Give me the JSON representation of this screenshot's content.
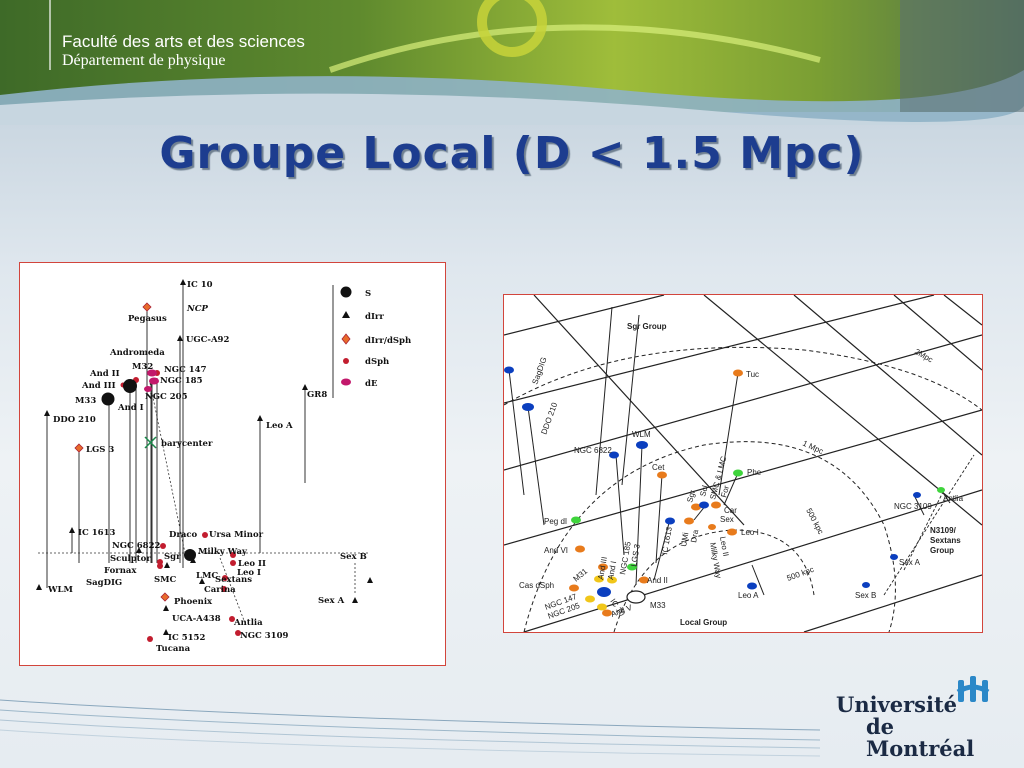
{
  "header": {
    "faculty": "Faculté des arts et des sciences",
    "department": "Département de physique"
  },
  "slide": {
    "title": "Groupe Local (D < 1.5 Mpc)"
  },
  "left_diagram": {
    "legend": [
      {
        "symbol": "S",
        "shape": "circle-large"
      },
      {
        "symbol": "dIrr",
        "shape": "triangle"
      },
      {
        "symbol": "dIrr/dSph",
        "shape": "diamond"
      },
      {
        "symbol": "dSph",
        "shape": "dot"
      },
      {
        "symbol": "dE",
        "shape": "ellipse"
      }
    ],
    "barycenter_label": "barycenter",
    "labels": {
      "ic10": "IC 10",
      "ncp": "NCP",
      "pegasus": "Pegasus",
      "ugca92": "UGC-A92",
      "andromeda": "Andromeda",
      "and2": "And II",
      "m32": "M32",
      "ngc147": "NGC 147",
      "and3": "And III",
      "ngc185": "NGC 185",
      "m33": "M33",
      "ngc205": "NGC 205",
      "and1": "And I",
      "gr8": "GR8",
      "ddo210": "DDO 210",
      "leoa": "Leo A",
      "lgs3": "LGS 3",
      "ic1613": "IC 1613",
      "draco": "Draco",
      "ursaminor": "Ursa Minor",
      "ngc6822": "NGC 6822",
      "milkyway": "Milky Way",
      "sculptor": "Sculptor",
      "sgr": "Sgr",
      "leo2": "Leo II",
      "fornax": "Fornax",
      "lmc": "LMC",
      "leo1": "Leo I",
      "sagdig": "SagDIG",
      "smc": "SMC",
      "sextans": "Sextans",
      "carina": "Carina",
      "wlm": "WLM",
      "sexb": "Sex B",
      "phoenix": "Phoenix",
      "sexa": "Sex A",
      "uca438": "UCA-A438",
      "antlia": "Antlia",
      "ic5152": "IC 5152",
      "ngc3109": "NGC 3109",
      "tucana": "Tucana"
    }
  },
  "right_diagram": {
    "labels": {
      "sgrgroup": "Sgr Group",
      "tuc": "Tuc",
      "sagdig": "SagDIG",
      "ddo210": "DDO 210",
      "twompc": "2Mpc",
      "ngc6822": "NGC 6822",
      "wlm": "WLM",
      "onempc": "1 Mpc",
      "cet": "Cet",
      "phe": "Phe",
      "smclmc": "SMC & LMC",
      "sgr": "Sgr",
      "scl": "Scl",
      "for": "For",
      "car": "Car",
      "sex": "Sex",
      "peg": "Peg dI",
      "umi": "UMi",
      "dra": "Dra",
      "milkyway": "Milky Way",
      "leo2": "Leo II",
      "leo1": "Leo I",
      "ic1613": "IC 1613",
      "fivehundred1": "500 kpc",
      "ngc3109": "NGC 3109",
      "antlia": "Antlia",
      "andvi": "And VI",
      "and3": "And III",
      "and1": "And I",
      "ngc185": "NGC 185",
      "lgs3": "LGS 3",
      "n3109group": "N3109/ Sextans Group",
      "sexa": "Sex A",
      "casdsph": "Cas dSph",
      "andii": "And II",
      "fivehundred2": "500 kpc",
      "leoa": "Leo A",
      "sexb": "Sex B",
      "m31": "M31",
      "ngc147": "NGC 147",
      "ngc205": "NGC 205",
      "ic10": "IC 10",
      "andv": "And V",
      "m33": "M33",
      "localgroup": "Local Group"
    },
    "colors": {
      "blue": "#0b3fbf",
      "orange": "#e87b1c",
      "green": "#3fd43c",
      "yellow": "#f1c619"
    }
  },
  "logo": {
    "name_line1": "Université",
    "name_line2": "de Montréal"
  }
}
